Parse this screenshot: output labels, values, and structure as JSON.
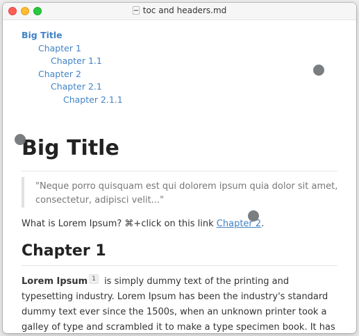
{
  "window": {
    "title": "toc and headers.md",
    "file_icon": "markdown-file-icon"
  },
  "toc": {
    "items": [
      {
        "label": "Big Title",
        "level": 1
      },
      {
        "label": "Chapter 1",
        "level": 2
      },
      {
        "label": "Chapter 1.1",
        "level": 3
      },
      {
        "label": "Chapter 2",
        "level": 2
      },
      {
        "label": "Chapter 2.1",
        "level": 3
      },
      {
        "label": "Chapter 2.1.1",
        "level": 4
      }
    ]
  },
  "document": {
    "h1": "Big Title",
    "blockquote": "\"Neque porro quisquam est qui dolorem ipsum quia dolor sit amet, consectetur, adipisci velit...\"",
    "para1_prefix": "What is Lorem Ipsum? ⌘+click on this link ",
    "para1_link": "Chapter 2",
    "para1_suffix": ".",
    "h2": "Chapter 1",
    "para2_bold": "Lorem Ipsum",
    "para2_footnote": "1",
    "para2_text": " is simply dummy text of the printing and typesetting industry. Lorem Ipsum has been the industry's standard dummy text ever since the 1500s, when an unknown printer took a galley of type and scrambled it to make a type specimen book. It has survived not only five"
  },
  "colors": {
    "link": "#4183c4",
    "text": "#333333",
    "heading": "#222222",
    "quote_text": "#777777",
    "close": "#fe5f57",
    "minimize": "#febc2e",
    "maximize": "#28c840"
  }
}
